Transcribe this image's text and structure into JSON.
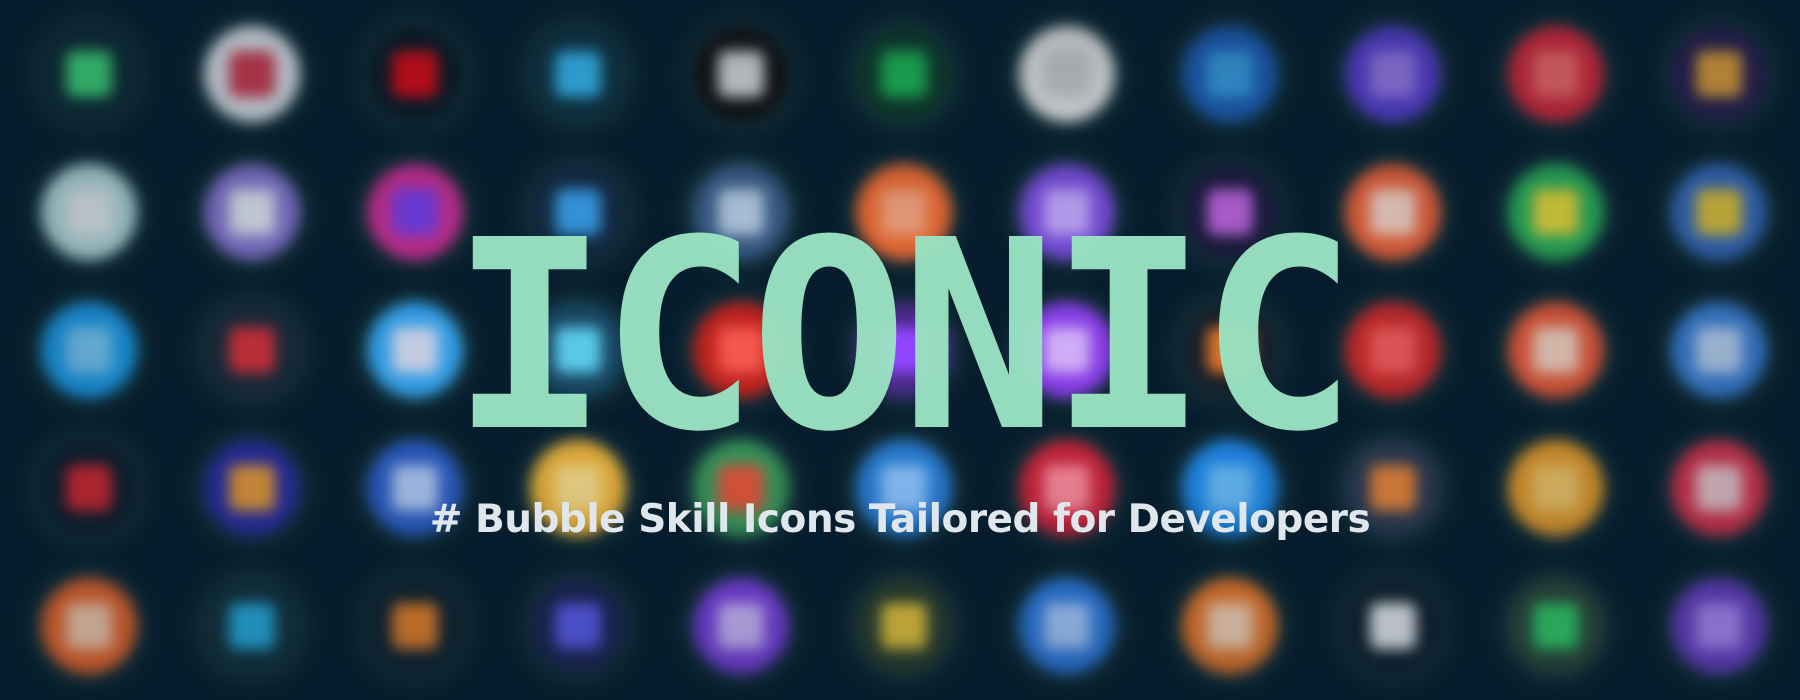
{
  "banner": {
    "title": "ICONIC",
    "tagline": "# Bubble Skill Icons Tailored for Developers"
  },
  "colors": {
    "background": "#071c2c",
    "title": "#9ae4c3",
    "tagline": "#dfe6ec"
  },
  "bubble_rows": [
    [
      {
        "icon": "nuxt-icon",
        "bg": "#0e2a33",
        "fg": "#3fd87a"
      },
      {
        "icon": "vivaldi-icon",
        "bg": "#e9eef5",
        "fg": "#d83b4f"
      },
      {
        "icon": "netflix-icon",
        "bg": "#0a1a24",
        "fg": "#e50914"
      },
      {
        "icon": "tailwind-icon",
        "bg": "#0f3442",
        "fg": "#38bdf8"
      },
      {
        "icon": "next-icon",
        "bg": "#111111",
        "fg": "#dddddd"
      },
      {
        "icon": "spotify-icon",
        "bg": "#0f3b2a",
        "fg": "#1db954"
      },
      {
        "icon": "notion-icon",
        "bg": "#e9e9e9",
        "fg": "#cfcfcf"
      },
      {
        "icon": "globe-icon",
        "bg": "#1d5fb8",
        "fg": "#3aa0e6"
      },
      {
        "icon": "phantom-icon",
        "bg": "#5b3fd6",
        "fg": "#a07cf0"
      },
      {
        "icon": "opera-icon",
        "bg": "#e0283a",
        "fg": "#ff6b6b"
      },
      {
        "icon": "rocket-icon",
        "bg": "#2a1e4f",
        "fg": "#e8a33a"
      }
    ],
    [
      {
        "icon": "terminal-icon",
        "bg": "#bfe3e6",
        "fg": "#f0f7f8"
      },
      {
        "icon": "ellipse-icon",
        "bg": "#8c7ad8",
        "fg": "#eef0fb"
      },
      {
        "icon": "gradient-app-icon",
        "bg": "#d42f98",
        "fg": "#7b3ff0"
      },
      {
        "icon": "flutter-icon",
        "bg": "#142a44",
        "fg": "#3aa3f0"
      },
      {
        "icon": "postgres-icon",
        "bg": "#3c5f8a",
        "fg": "#b9cfe6"
      },
      {
        "icon": "postman-icon",
        "bg": "#f06b33",
        "fg": "#f7a27a"
      },
      {
        "icon": "message-icon",
        "bg": "#7d4fe0",
        "fg": "#c6a8ff"
      },
      {
        "icon": "astro-icon",
        "bg": "#1b1a3c",
        "fg": "#c064e0"
      },
      {
        "icon": "mongo-leaf-icon",
        "bg": "#f4643a",
        "fg": "#ffd9c9"
      },
      {
        "icon": "colorwheel-icon",
        "bg": "#2db85c",
        "fg": "#f2e23a"
      },
      {
        "icon": "python-icon",
        "bg": "#3a70c8",
        "fg": "#f2cf3a"
      }
    ],
    [
      {
        "icon": "twitter-icon",
        "bg": "#1da1f2",
        "fg": "#7cd0ff"
      },
      {
        "icon": "debian-icon",
        "bg": "#1c2b3a",
        "fg": "#e0323a"
      },
      {
        "icon": "messenger-icon",
        "bg": "#3ab0ff",
        "fg": "#e0e8ff"
      },
      {
        "icon": "react-icon",
        "bg": "#1a4b68",
        "fg": "#61dafb"
      },
      {
        "icon": "ruby-icon",
        "bg": "#c7231d",
        "fg": "#ff5a4f"
      },
      {
        "icon": "twitch-icon",
        "bg": "#4b2a8a",
        "fg": "#9146ff"
      },
      {
        "icon": "messenger-purple-icon",
        "bg": "#8f3ff0",
        "fg": "#d8b5ff"
      },
      {
        "icon": "codepen-icon",
        "bg": "#18202a",
        "fg": "#f07b2a"
      },
      {
        "icon": "angular-icon",
        "bg": "#d12a2a",
        "fg": "#ff5b5b"
      },
      {
        "icon": "pocket-icon",
        "bg": "#f25c3a",
        "fg": "#ffd9c4"
      },
      {
        "icon": "safari-icon",
        "bg": "#3f86e0",
        "fg": "#c3dcff"
      }
    ],
    [
      {
        "icon": "scala-icon",
        "bg": "#0e1d2a",
        "fg": "#e0262e"
      },
      {
        "icon": "firebase-icon",
        "bg": "#2c2ea8",
        "fg": "#f2a03a"
      },
      {
        "icon": "stacks-icon",
        "bg": "#2f61d0",
        "fg": "#b8d2ff"
      },
      {
        "icon": "sketch-icon",
        "bg": "#f5b93a",
        "fg": "#ffe08a"
      },
      {
        "icon": "google-cloud-icon",
        "bg": "#3a9a5c",
        "fg": "#e8553a"
      },
      {
        "icon": "cloud-icon",
        "bg": "#2a7fd8",
        "fg": "#8cc4ff"
      },
      {
        "icon": "laravel-icon",
        "bg": "#d0233a",
        "fg": "#ff8a9a"
      },
      {
        "icon": "docker-icon",
        "bg": "#1f8cf0",
        "fg": "#6cc0ff"
      },
      {
        "icon": "svelte-icon",
        "bg": "#2e3b52",
        "fg": "#f0883a"
      },
      {
        "icon": "solid-icon",
        "bg": "#f0a12a",
        "fg": "#ffce6a"
      },
      {
        "icon": "nest-icon",
        "bg": "#e7344e",
        "fg": "#ffd2d8"
      }
    ],
    [
      {
        "icon": "gitlab-icon",
        "bg": "#f2672a",
        "fg": "#ffd0b0"
      },
      {
        "icon": "prisma-icon",
        "bg": "#13323c",
        "fg": "#2ab3e8"
      },
      {
        "icon": "prettier-icon",
        "bg": "#10222e",
        "fg": "#f0842a"
      },
      {
        "icon": "vite-icon",
        "bg": "#1c2452",
        "fg": "#5c5cf0"
      },
      {
        "icon": "darkmode-icon",
        "bg": "#7b3fe0",
        "fg": "#d0b8ff"
      },
      {
        "icon": "vue-icon",
        "bg": "#2b3d2c",
        "fg": "#e6c53a"
      },
      {
        "icon": "typescript-icon",
        "bg": "#2f7ae0",
        "fg": "#a8ccff"
      },
      {
        "icon": "ubuntu-icon",
        "bg": "#f07a2a",
        "fg": "#ffd9b8"
      },
      {
        "icon": "triangle-icon",
        "bg": "#10202c",
        "fg": "#f4f6f8"
      },
      {
        "icon": "nginx-icon",
        "bg": "#2e4a3a",
        "fg": "#35d46a"
      },
      {
        "icon": "visual-studio-icon",
        "bg": "#6b3fc8",
        "fg": "#b48cff"
      }
    ]
  ]
}
